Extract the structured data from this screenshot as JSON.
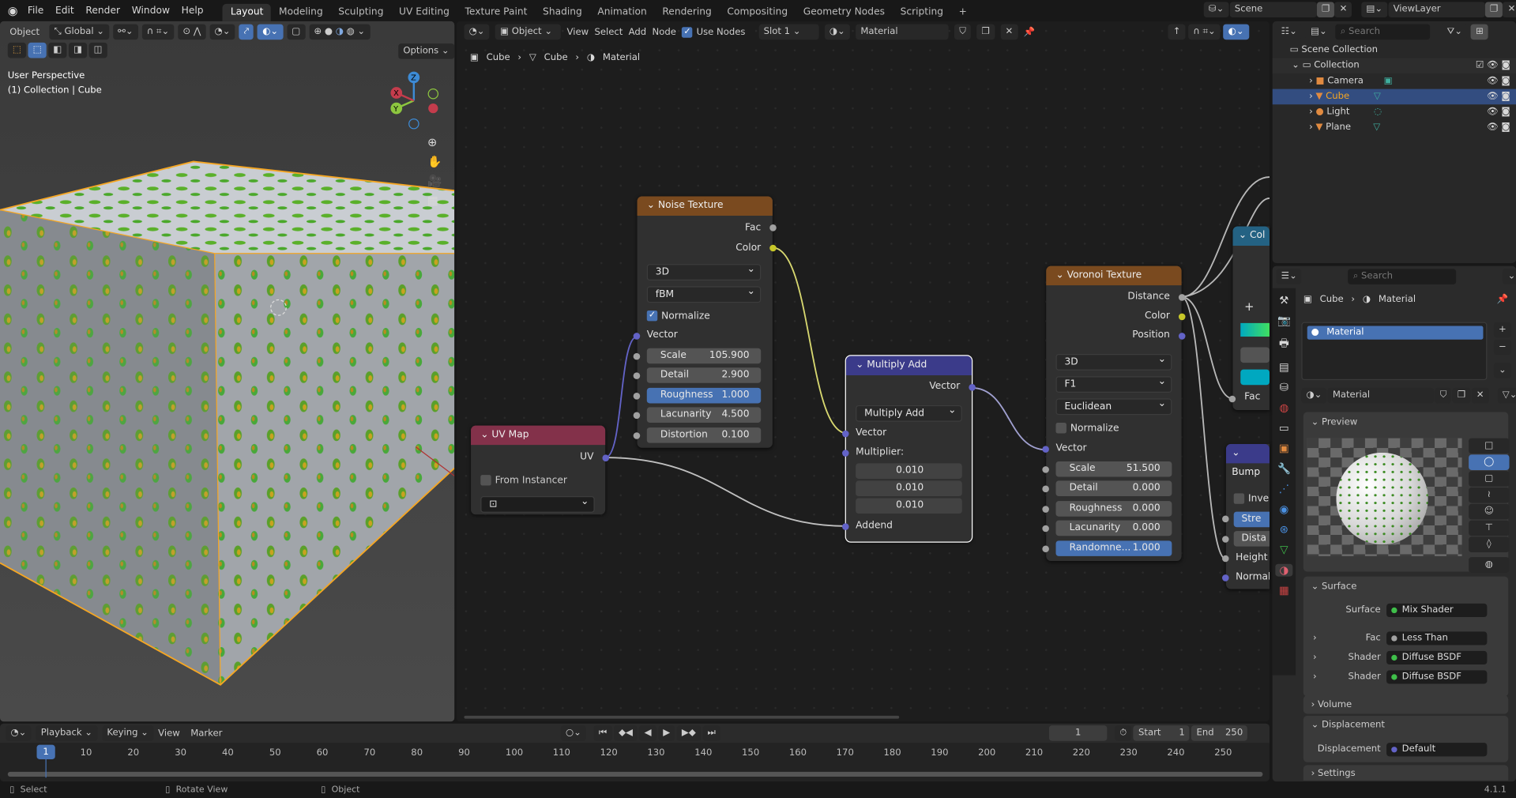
{
  "menu": [
    "File",
    "Edit",
    "Render",
    "Window",
    "Help"
  ],
  "workspaces": [
    "Layout",
    "Modeling",
    "Sculpting",
    "UV Editing",
    "Texture Paint",
    "Shading",
    "Animation",
    "Rendering",
    "Compositing",
    "Geometry Nodes",
    "Scripting"
  ],
  "active_workspace": "Layout",
  "scene": "Scene",
  "view_layer": "ViewLayer",
  "viewport": {
    "mode": "Object",
    "orientation": "Global",
    "options": "Options",
    "info1": "User Perspective",
    "info2": "(1) Collection | Cube",
    "axes": {
      "x": "X",
      "y": "Y",
      "z": "Z"
    }
  },
  "node_editor": {
    "mode": "Object",
    "menus": [
      "View",
      "Select",
      "Add",
      "Node"
    ],
    "use_nodes": "Use Nodes",
    "slot": "Slot 1",
    "material": "Material",
    "breadcrumb": [
      "Cube",
      "Cube",
      "Material"
    ]
  },
  "nodes": {
    "noise": {
      "title": "Noise Texture",
      "outputs": [
        "Fac",
        "Color"
      ],
      "dim": "3D",
      "type": "fBM",
      "normalize": "Normalize",
      "vector": "Vector",
      "fields": [
        [
          "Scale",
          "105.900"
        ],
        [
          "Detail",
          "2.900"
        ],
        [
          "Roughness",
          "1.000"
        ],
        [
          "Lacunarity",
          "4.500"
        ],
        [
          "Distortion",
          "0.100"
        ]
      ]
    },
    "uvmap": {
      "title": "UV Map",
      "output": "UV",
      "from_instancer": "From Instancer"
    },
    "multiply": {
      "title": "Multiply Add",
      "output": "Vector",
      "op": "Multiply Add",
      "vector": "Vector",
      "multiplier": "Multiplier:",
      "values": [
        "0.010",
        "0.010",
        "0.010"
      ],
      "addend": "Addend"
    },
    "voronoi": {
      "title": "Voronoi Texture",
      "outputs": [
        "Distance",
        "Color",
        "Position"
      ],
      "dim": "3D",
      "feature": "F1",
      "metric": "Euclidean",
      "normalize": "Normalize",
      "vector": "Vector",
      "fields": [
        [
          "Scale",
          "51.500"
        ],
        [
          "Detail",
          "0.000"
        ],
        [
          "Roughness",
          "0.000"
        ],
        [
          "Lacunarity",
          "0.000"
        ],
        [
          "Randomne...",
          "1.000"
        ]
      ]
    },
    "colorramp": {
      "title": "Col",
      "fac": "Fac"
    },
    "bump": {
      "title": "Bump",
      "invert": "Inve",
      "strength": "Stre",
      "distance": "Dista",
      "height": "Height",
      "normal": "Normal"
    }
  },
  "outliner": {
    "search": "Search",
    "scene_collection": "Scene Collection",
    "collection": "Collection",
    "items": [
      "Camera",
      "Cube",
      "Light",
      "Plane"
    ],
    "selected": "Cube"
  },
  "properties": {
    "search": "Search",
    "breadcrumb": [
      "Cube",
      "Material"
    ],
    "slot": "Material",
    "material_name": "Material",
    "preview": "Preview",
    "surface_header": "Surface",
    "rows": [
      [
        "Surface",
        "Mix Shader",
        "#3fbf4a"
      ],
      [
        "Fac",
        "Less Than",
        "#a1a1a1"
      ],
      [
        "Shader",
        "Diffuse BSDF",
        "#3fbf4a"
      ],
      [
        "Shader",
        "Diffuse BSDF",
        "#3fbf4a"
      ]
    ],
    "volume": "Volume",
    "displacement_header": "Displacement",
    "displacement": [
      "Displacement",
      "Default",
      "#6363c7"
    ],
    "settings": "Settings"
  },
  "timeline": {
    "menus": [
      "Playback",
      "Keying",
      "View",
      "Marker"
    ],
    "current": "1",
    "start_label": "Start",
    "start": "1",
    "end_label": "End",
    "end": "250",
    "ticks": [
      "1",
      "10",
      "20",
      "30",
      "40",
      "50",
      "60",
      "70",
      "80",
      "90",
      "100",
      "110",
      "120",
      "130",
      "140",
      "150",
      "160",
      "170",
      "180",
      "190",
      "200",
      "210",
      "220",
      "230",
      "240",
      "250"
    ]
  },
  "status": {
    "items": [
      "Select",
      "Rotate View",
      "Object"
    ],
    "version": "4.1.1"
  },
  "colors": {
    "accent": "#4772b3",
    "texture_header": "#7a4a1f",
    "vector_header": "#3b3b8a",
    "input_header": "#83314a",
    "converter_header": "#246283",
    "selected_orange": "#f5a623"
  }
}
